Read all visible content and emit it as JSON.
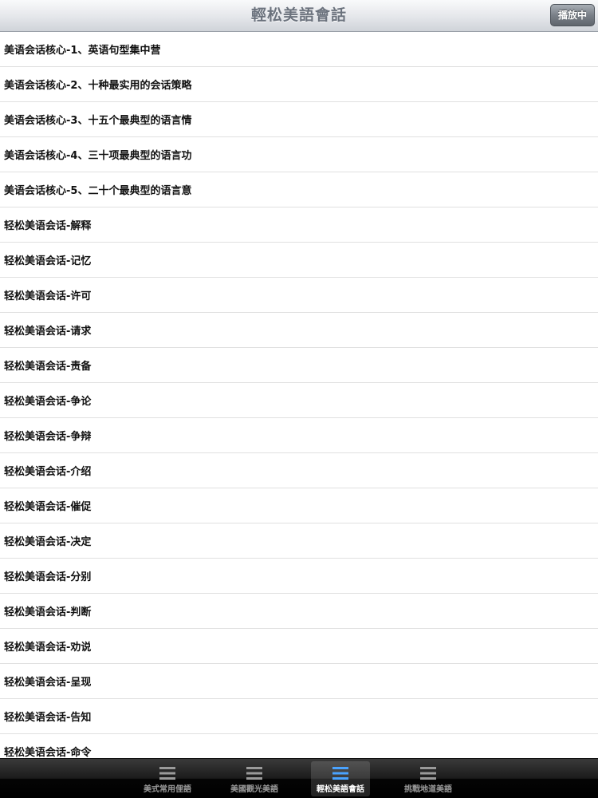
{
  "navbar": {
    "title": "輕松美語會話",
    "right_button_label": "播放中"
  },
  "list": {
    "items": [
      "美语会话核心-1、英语句型集中营",
      "美语会话核心-2、十种最实用的会话策略",
      "美语会话核心-3、十五个最典型的语言情",
      "美语会话核心-4、三十项最典型的语言功",
      "美语会话核心-5、二十个最典型的语言意",
      "轻松美语会话-解释",
      "轻松美语会话-记忆",
      "轻松美语会话-许可",
      "轻松美语会话-请求",
      "轻松美语会话-责备",
      "轻松美语会话-争论",
      "轻松美语会话-争辩",
      "轻松美语会话-介绍",
      "轻松美语会话-催促",
      "轻松美语会话-决定",
      "轻松美语会话-分别",
      "轻松美语会话-判断",
      "轻松美语会话-劝说",
      "轻松美语会话-呈现",
      "轻松美语会话-告知",
      "轻松美语会话-命令"
    ]
  },
  "tabbar": {
    "tabs": [
      {
        "label": "美式常用俚語",
        "icon": "list-icon",
        "active": false
      },
      {
        "label": "美國觀光美語",
        "icon": "list-icon",
        "active": false
      },
      {
        "label": "輕松美語會話",
        "icon": "list-icon",
        "active": true
      },
      {
        "label": "挑戰地道美語",
        "icon": "list-icon",
        "active": false
      }
    ],
    "active_icon_color": "#4aa3ff",
    "inactive_icon_color": "#9a9a9a"
  }
}
